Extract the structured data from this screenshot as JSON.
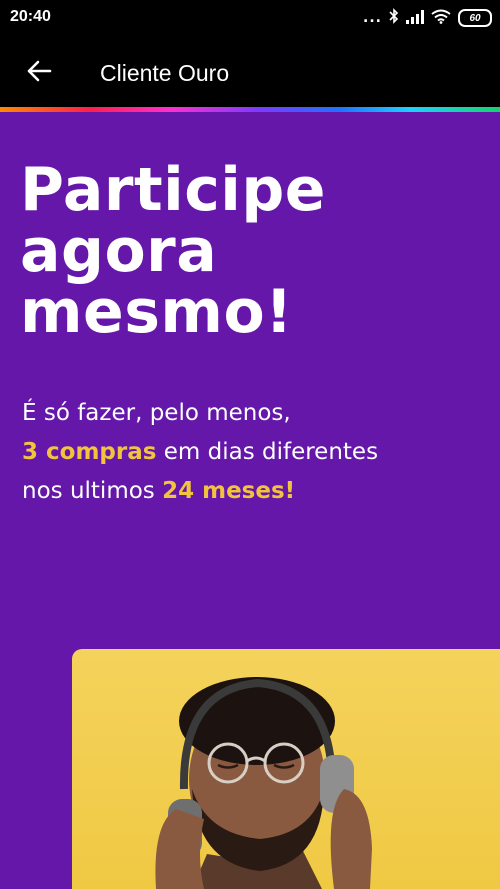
{
  "status_bar": {
    "time": "20:40",
    "dots": "...",
    "battery": "60"
  },
  "app_bar": {
    "title": "Cliente Ouro",
    "back_icon": "arrow-left-icon"
  },
  "headline": {
    "lines": [
      "Participe",
      "agora",
      "mesmo!"
    ]
  },
  "subtitle": {
    "line1": "É só fazer, pelo menos,",
    "line2_highlight": "3 compras",
    "line2_rest": " em dias diferentes",
    "line3_prefix": "nos ultimos ",
    "line3_highlight": "24 meses!"
  },
  "colors": {
    "background": "#6417a9",
    "highlight": "#f2c33f",
    "card": "#f4d35c",
    "app_bar": "#000000"
  }
}
